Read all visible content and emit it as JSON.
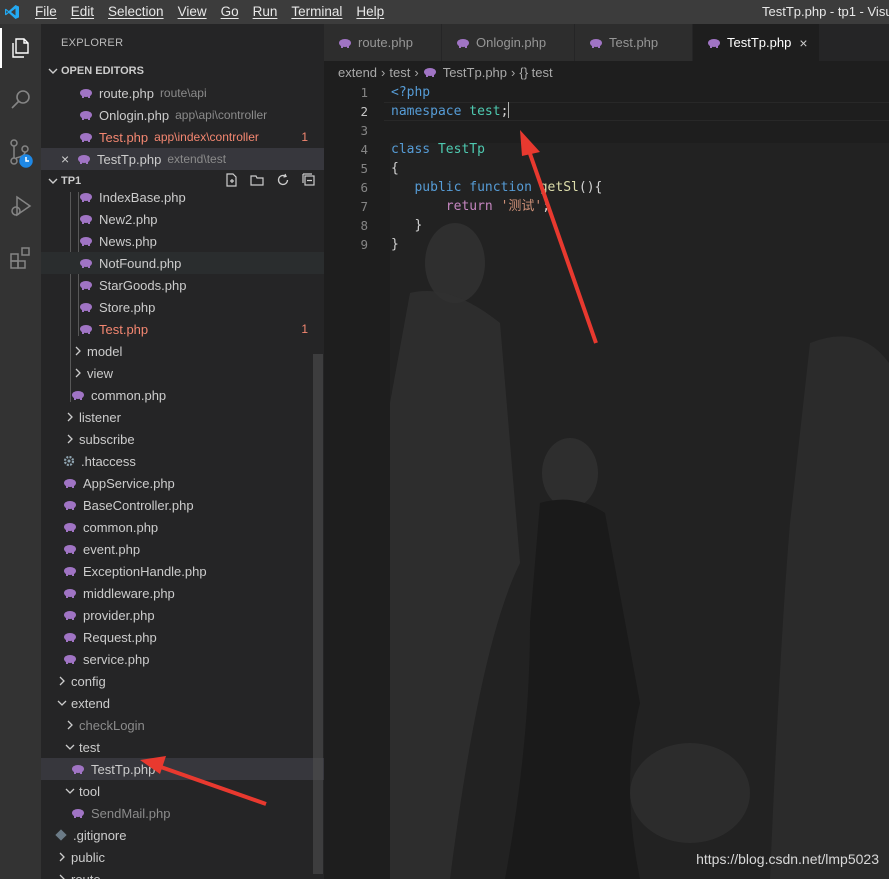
{
  "titlebar": {
    "menu": [
      "File",
      "Edit",
      "Selection",
      "View",
      "Go",
      "Run",
      "Terminal",
      "Help"
    ],
    "window_title": "TestTp.php - tp1 - Visu"
  },
  "sidebar": {
    "explorer_title": "EXPLORER",
    "open_editors_header": "OPEN EDITORS",
    "open_editors": [
      {
        "name": "route.php",
        "desc": "route\\api",
        "error": false,
        "badge": ""
      },
      {
        "name": "Onlogin.php",
        "desc": "app\\api\\controller",
        "error": false,
        "badge": ""
      },
      {
        "name": "Test.php",
        "desc": "app\\index\\controller",
        "error": true,
        "badge": "1"
      },
      {
        "name": "TestTp.php",
        "desc": "extend\\test",
        "error": false,
        "badge": "",
        "close": "×"
      }
    ],
    "project_header": "TP1",
    "tree": [
      {
        "name": "IndexBase.php",
        "kind": "php"
      },
      {
        "name": "New2.php",
        "kind": "php"
      },
      {
        "name": "News.php",
        "kind": "php"
      },
      {
        "name": "NotFound.php",
        "kind": "php"
      },
      {
        "name": "StarGoods.php",
        "kind": "php"
      },
      {
        "name": "Store.php",
        "kind": "php"
      },
      {
        "name": "Test.php",
        "kind": "php",
        "error": true,
        "badge": "1"
      },
      {
        "name": "model",
        "kind": "folder"
      },
      {
        "name": "view",
        "kind": "folder"
      },
      {
        "name": "common.php",
        "kind": "php"
      },
      {
        "name": "listener",
        "kind": "folder"
      },
      {
        "name": "subscribe",
        "kind": "folder"
      },
      {
        "name": ".htaccess",
        "kind": "gear"
      },
      {
        "name": "AppService.php",
        "kind": "php"
      },
      {
        "name": "BaseController.php",
        "kind": "php"
      },
      {
        "name": "common.php",
        "kind": "php"
      },
      {
        "name": "event.php",
        "kind": "php"
      },
      {
        "name": "ExceptionHandle.php",
        "kind": "php"
      },
      {
        "name": "middleware.php",
        "kind": "php"
      },
      {
        "name": "provider.php",
        "kind": "php"
      },
      {
        "name": "Request.php",
        "kind": "php"
      },
      {
        "name": "service.php",
        "kind": "php"
      },
      {
        "name": "config",
        "kind": "folder"
      },
      {
        "name": "extend",
        "kind": "folder-open"
      },
      {
        "name": "checkLogin",
        "kind": "folder"
      },
      {
        "name": "test",
        "kind": "folder-open"
      },
      {
        "name": "TestTp.php",
        "kind": "php"
      },
      {
        "name": "tool",
        "kind": "folder-open"
      },
      {
        "name": "SendMail.php",
        "kind": "php"
      },
      {
        "name": ".gitignore",
        "kind": "git"
      },
      {
        "name": "public",
        "kind": "folder"
      },
      {
        "name": "route",
        "kind": "folder"
      }
    ]
  },
  "tabs": [
    {
      "label": "route.php",
      "active": false
    },
    {
      "label": "Onlogin.php",
      "active": false
    },
    {
      "label": "Test.php",
      "active": false
    },
    {
      "label": "TestTp.php",
      "active": true,
      "close": "×"
    }
  ],
  "breadcrumbs": [
    "extend",
    "test",
    "TestTp.php",
    "{} test"
  ],
  "editor": {
    "line_numbers": [
      "1",
      "2",
      "3",
      "4",
      "5",
      "6",
      "7",
      "8",
      "9"
    ],
    "code": {
      "l1": "<?php",
      "l2_kw": "namespace",
      "l2_name": "test",
      "l2_semi": ";",
      "l4_kw": "class",
      "l4_name": "TestTp",
      "l5": "{",
      "l6_kw1": "public",
      "l6_kw2": "function",
      "l6_fn": "getSl",
      "l6_rest": "(){",
      "l7_kw": "return",
      "l7_str": "'测试'",
      "l7_semi": ";",
      "l8": "}",
      "l9": "}"
    },
    "watermark": "https://blog.csdn.net/lmp5023"
  },
  "colors": {
    "accent": "#007acc",
    "php_icon": "#a074c4",
    "error": "#f48771",
    "arrow": "#e8392f"
  }
}
